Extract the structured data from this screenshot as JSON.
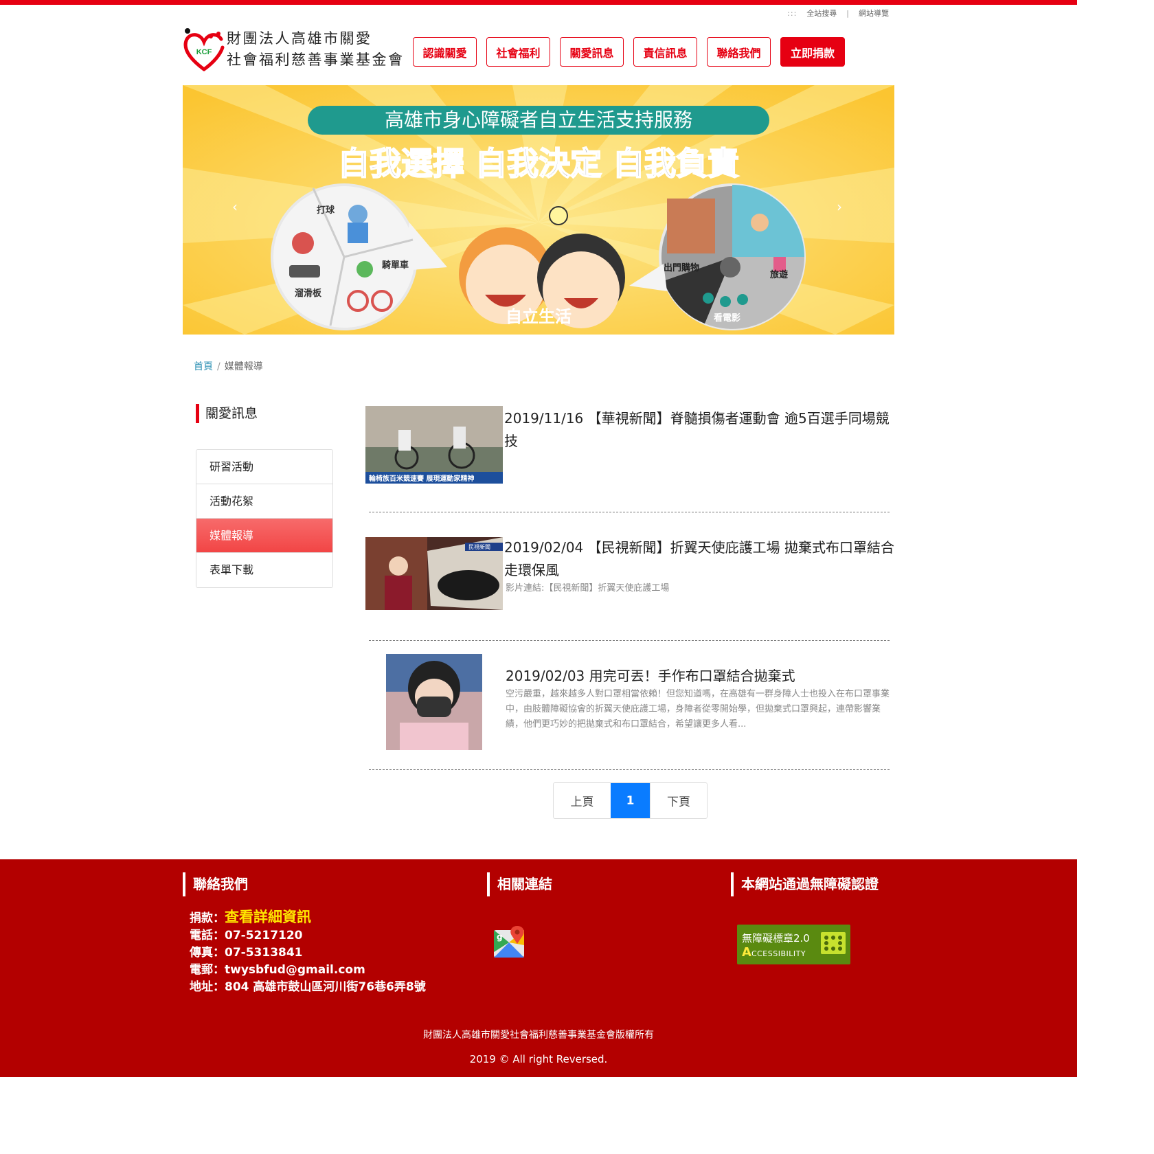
{
  "header": {
    "utility_links": [
      ":::",
      "全站搜尋",
      "|",
      "網站導覽"
    ],
    "logo": {
      "line1": "財團法人高雄市關愛",
      "line2": "社會福利慈善事業基金會",
      "badge": "KCF"
    },
    "nav": [
      "認識關愛",
      "社會福利",
      "關愛訊息",
      "責信訊息",
      "聯絡我們"
    ],
    "donate": "立即捐款"
  },
  "banner": {
    "subtitle": "高雄市身心障礙者自立生活支持服務",
    "headline": "自我選擇  自我決定  自我負責",
    "left_labels": [
      "打球",
      "騎單車",
      "溜滑板"
    ],
    "right_labels": [
      "出門購物",
      "旅遊",
      "看電影"
    ],
    "caption": "自立生活",
    "prev": "‹",
    "next": "›",
    "colors": {
      "bg": "#fcd34a",
      "pill": "#1f9a8e"
    }
  },
  "breadcrumb": {
    "home": "首頁",
    "separator": "/",
    "current": "媒體報導"
  },
  "sidebar": {
    "title": "關愛訊息",
    "items": [
      "研習活動",
      "活動花絮",
      "媒體報導",
      "表單下載"
    ]
  },
  "news": [
    {
      "title": "2019/11/16 【華視新聞】脊髓損傷者運動會 逾5百選手同場競技",
      "desc": "",
      "thumb_caption": "輪椅族百米競速賽 展現運動家精神"
    },
    {
      "title": "2019/02/04 【民視新聞】折翼天使庇護工場 拋棄式布口罩結合走環保風",
      "desc": "影片連結:【民視新聞】折翼天使庇護工場",
      "thumb_caption": "民視新聞"
    },
    {
      "title": "2019/02/03 用完可丟！手作布口罩結合拋棄式",
      "desc": "空污嚴重，越來越多人對口罩相當依賴！但您知道嗎，在高雄有一群身障人士也投入在布口罩事業中，由肢體障礙協會的折翼天使庇護工場，身障者從零開始學，但拋棄式口罩興起，連帶影響業績，他們更巧妙的把拋棄式和布口罩結合，希望讓更多人看...",
      "thumb_caption": ""
    }
  ],
  "pager": {
    "prev": "上頁",
    "current": "1",
    "next": "下頁"
  },
  "footer": {
    "contact_title": "聯絡我們",
    "links_title": "相關連結",
    "a11y_title": "本網站通過無障礙認證",
    "donate_label": "捐款：",
    "donate_link": "查看詳細資訊",
    "phone": "電話：07-5217120",
    "fax": "傳真：07-5313841",
    "email": "電郵：twysbfud@gmail.com",
    "address": "地址：804 高雄市鼓山區河川街76巷6弄8號",
    "a11y_badge_line1": "無障礙標章2.0",
    "a11y_badge_line2": "CCESSIBILITY",
    "a11y_badge_letter": "A",
    "copyright1": "財團法人高雄市關愛社會福利慈善事業基金會版權所有",
    "copyright2": "2019 © All right Reversed."
  }
}
